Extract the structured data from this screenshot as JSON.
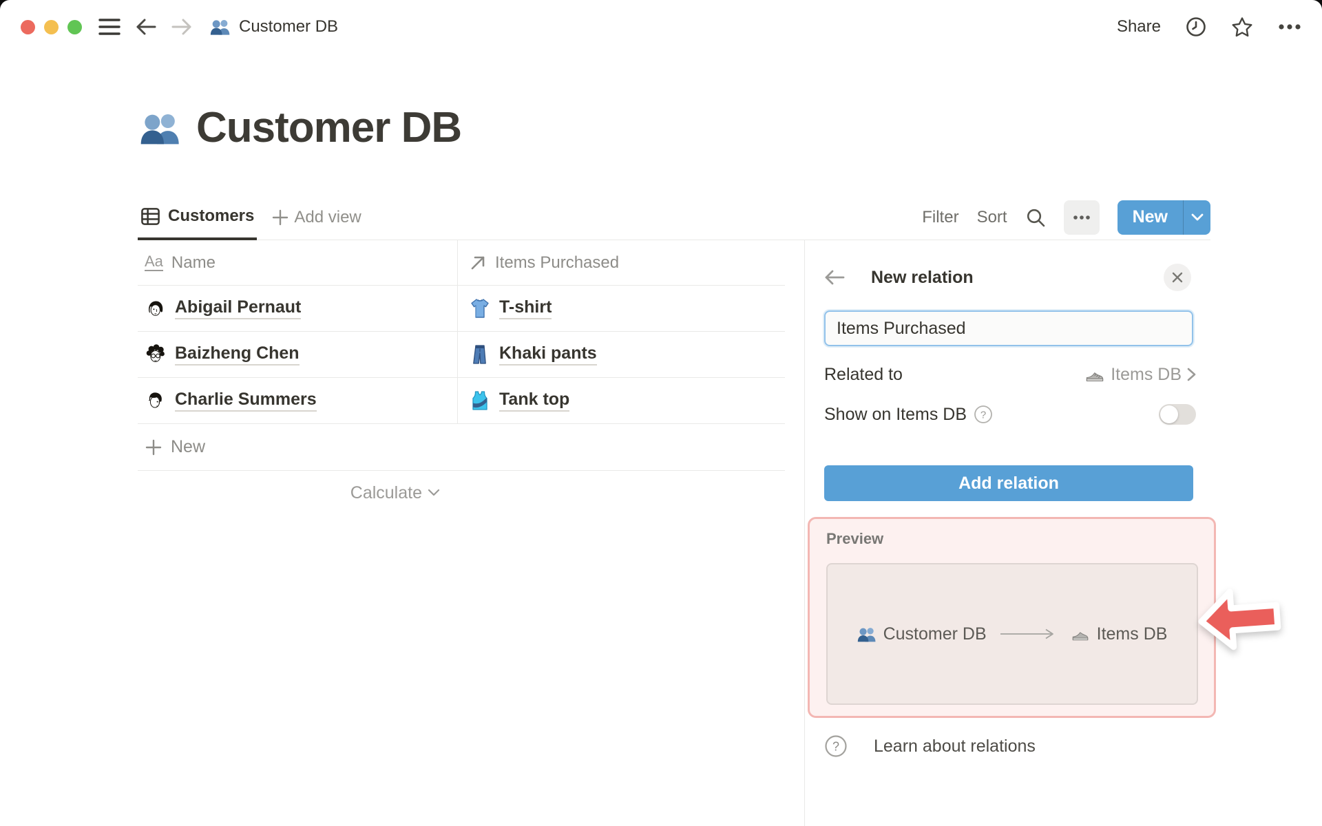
{
  "window": {
    "breadcrumb": "Customer DB"
  },
  "titlebar": {
    "share_label": "Share"
  },
  "page": {
    "title": "Customer DB"
  },
  "toolbar": {
    "tab_customers": "Customers",
    "add_view_label": "Add view",
    "filter_label": "Filter",
    "sort_label": "Sort",
    "new_label": "New"
  },
  "table": {
    "columns": [
      {
        "label": "Name"
      },
      {
        "label": "Items Purchased"
      }
    ],
    "rows": [
      {
        "name": "Abigail Pernaut",
        "item": "T-shirt"
      },
      {
        "name": "Baizheng Chen",
        "item": "Khaki pants"
      },
      {
        "name": "Charlie Summers",
        "item": "Tank top"
      }
    ],
    "new_row_label": "New",
    "calculate_label": "Calculate"
  },
  "panel": {
    "title": "New relation",
    "relation_name_value": "Items Purchased",
    "related_to_label": "Related to",
    "related_to_value": "Items DB",
    "show_on_label": "Show on Items DB",
    "toggle_state": "off",
    "add_relation_label": "Add relation",
    "preview": {
      "label": "Preview",
      "source": "Customer DB",
      "target": "Items DB"
    },
    "learn_label": "Learn about relations"
  },
  "colors": {
    "accent_blue": "#58a0d6",
    "annotation_red": "#ea5f5b",
    "annotation_pink": "#f3b7b3",
    "focus_blue": "#92c2ea"
  }
}
